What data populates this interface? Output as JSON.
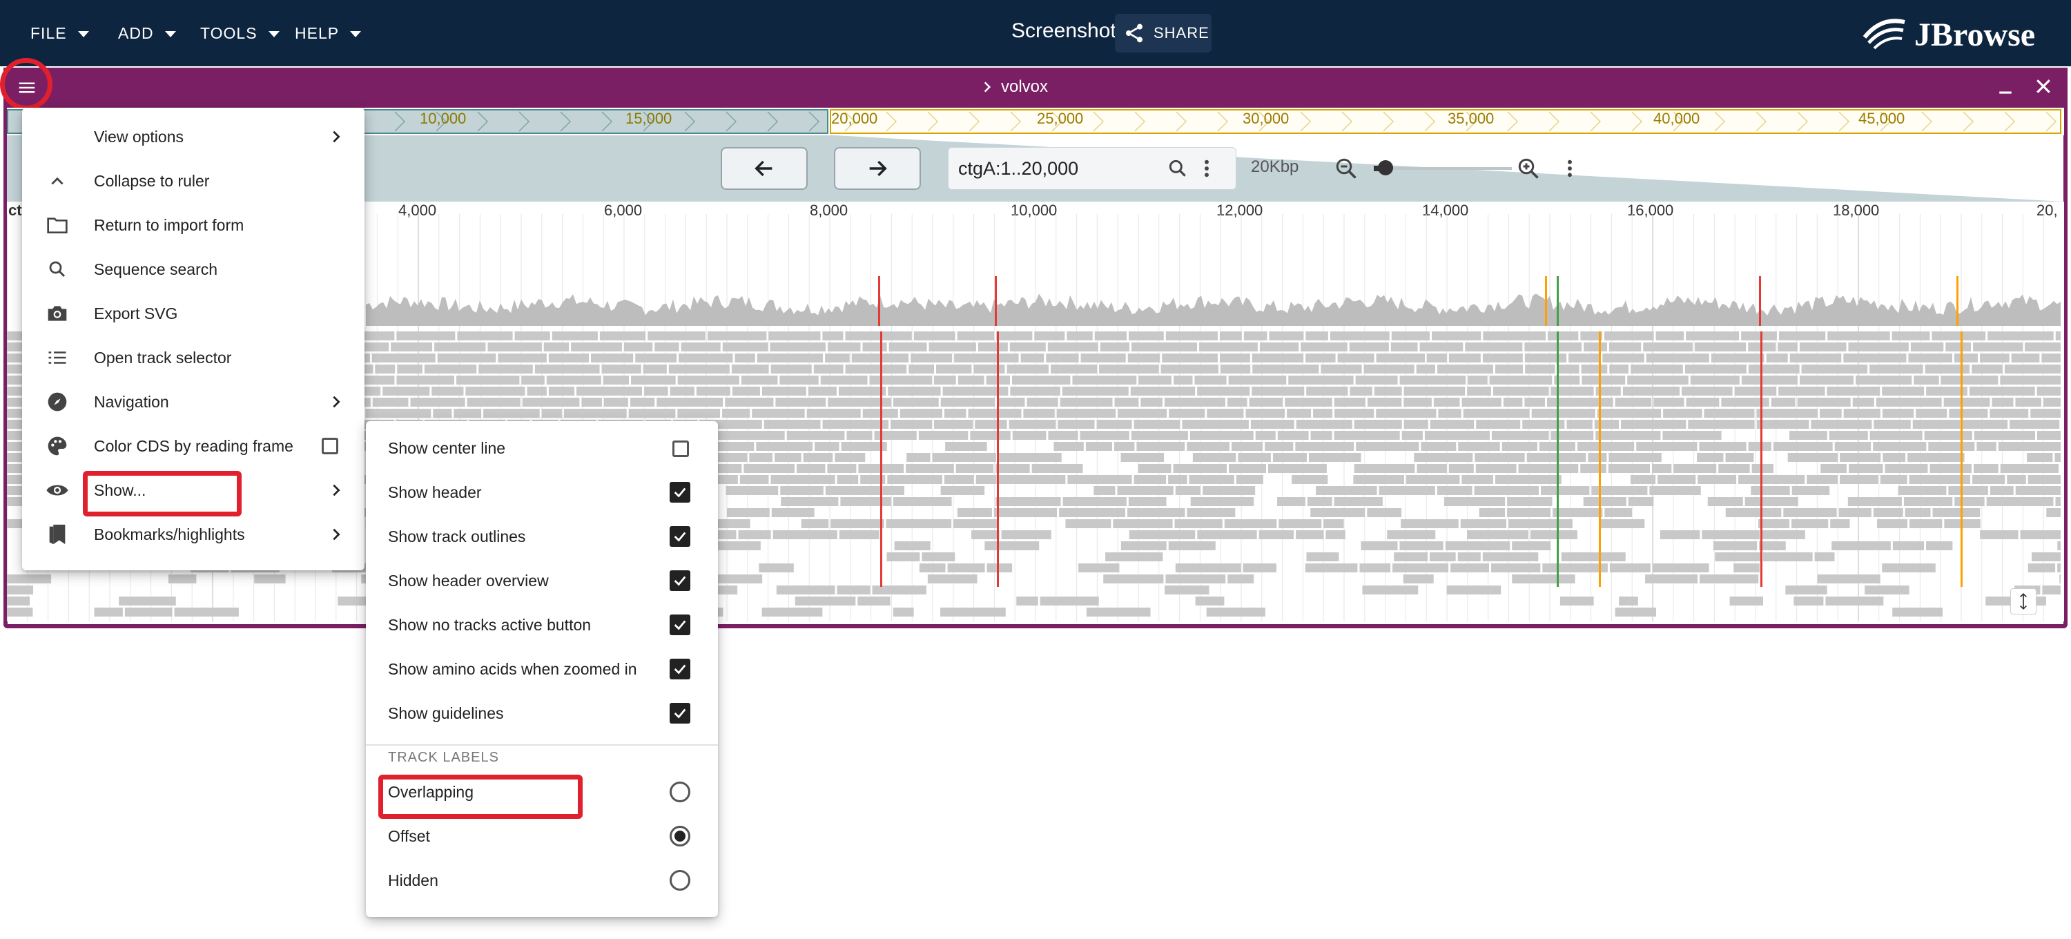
{
  "appbar": {
    "menus": [
      "FILE",
      "ADD",
      "TOOLS",
      "HELP"
    ],
    "title": "Screenshot",
    "share_label": "SHARE",
    "logo_text": "JBrowse"
  },
  "view": {
    "name": "volvox",
    "overview_ticks": [
      "10,000",
      "15,000",
      "20,000",
      "25,000",
      "30,000",
      "35,000",
      "40,000",
      "45,000"
    ],
    "location": "ctgA:1..20,000",
    "bp_label": "20Kbp",
    "ruler_ticks": [
      "4,000",
      "6,000",
      "8,000",
      "10,000",
      "12,000",
      "14,000",
      "16,000",
      "18,000",
      "20,"
    ],
    "ruler_left": "ct"
  },
  "main_menu": {
    "items": [
      {
        "label": "View options",
        "icon": "none",
        "submenu": true
      },
      {
        "label": "Collapse to ruler",
        "icon": "chevron-up-icon"
      },
      {
        "label": "Return to import form",
        "icon": "folder-icon"
      },
      {
        "label": "Sequence search",
        "icon": "search-icon"
      },
      {
        "label": "Export SVG",
        "icon": "camera-icon"
      },
      {
        "label": "Open track selector",
        "icon": "list-icon"
      },
      {
        "label": "Navigation",
        "icon": "compass-icon",
        "submenu": true
      },
      {
        "label": "Color CDS by reading frame",
        "icon": "palette-icon",
        "checkbox": false
      },
      {
        "label": "Show...",
        "icon": "eye-icon",
        "submenu": true
      },
      {
        "label": "Bookmarks/highlights",
        "icon": "bookmark-icon",
        "submenu": true
      }
    ]
  },
  "show_menu": {
    "items": [
      {
        "label": "Show center line",
        "checked": false
      },
      {
        "label": "Show header",
        "checked": true
      },
      {
        "label": "Show track outlines",
        "checked": true
      },
      {
        "label": "Show header overview",
        "checked": true
      },
      {
        "label": "Show no tracks active button",
        "checked": true
      },
      {
        "label": "Show amino acids when zoomed in",
        "checked": true
      },
      {
        "label": "Show guidelines",
        "checked": true
      }
    ],
    "section_header": "TRACK LABELS",
    "track_labels": [
      {
        "label": "Overlapping",
        "selected": false
      },
      {
        "label": "Offset",
        "selected": true
      },
      {
        "label": "Hidden",
        "selected": false
      }
    ]
  }
}
